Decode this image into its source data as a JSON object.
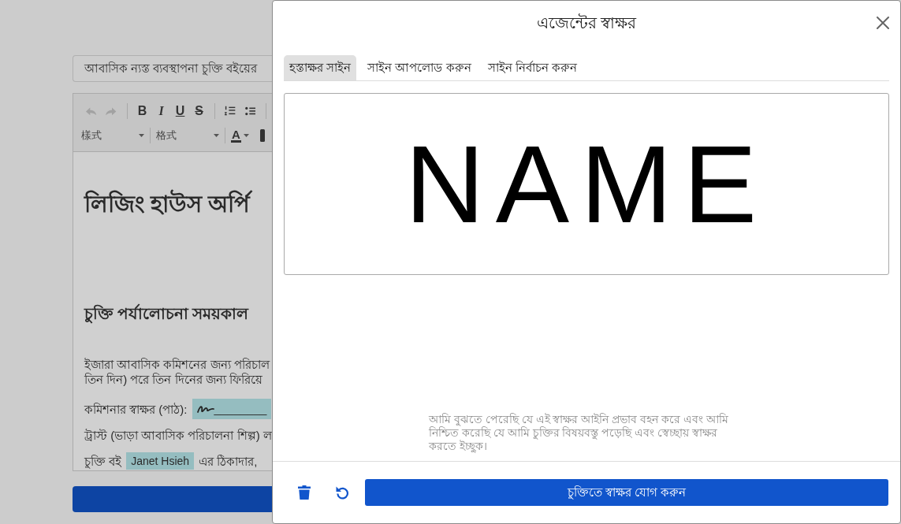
{
  "editor_page": {
    "title_field": {
      "value": "আবাসিক ন্যস্ত ব্যবস্থাপনা চুক্তি বইয়ের"
    },
    "toolbar": {
      "history": [
        {
          "kind": "undo",
          "disabled": true
        },
        {
          "kind": "redo",
          "disabled": true
        }
      ],
      "marks": [
        {
          "kind": "bold",
          "label": "B"
        },
        {
          "kind": "italic",
          "label": "I"
        },
        {
          "kind": "underline",
          "label": "U"
        },
        {
          "kind": "strike",
          "label": "S"
        }
      ],
      "selects": [
        {
          "value": "樣式"
        },
        {
          "value": "格式"
        }
      ],
      "text_color": {
        "label": "A"
      }
    },
    "document": {
      "heading": "লিজিং হাউস অর্পি",
      "subheading": "চুক্তি পর্যালোচনা সময়কাল",
      "intro_lines": [
        "ইজারা আবাসিক কমিশনের জন্য পরিচাল",
        "তিন দিন) পরে তিন দিনের জন্য ফিরিয়ে"
      ],
      "signature_line": {
        "label": "কমিশনার স্বাক্ষর (পাঠ):",
        "blank": "________"
      },
      "trust_line": "ট্রাস্ট (ভাড়া আবাসিক পরিচালনা শিল্প) ল",
      "book_line": {
        "before": "চুক্তি বই",
        "name": "Janet Hsieh",
        "after": "এর ঠিকাদার,"
      }
    }
  },
  "dialog": {
    "title": "এজেন্টের স্বাক্ষর",
    "tabs": [
      {
        "label": "হস্তাক্ষর সাইন",
        "selected": true
      },
      {
        "label": "সাইন আপলোড করুন",
        "selected": false
      },
      {
        "label": "সাইন নির্বাচন করুন",
        "selected": false
      }
    ],
    "signature": "NAME",
    "consent": "আমি বুঝতে পেরেছি যে এই স্বাক্ষর আইনি প্রভাব বহন করে এবং আমি নিশ্চিত করেছি যে আমি চুক্তির বিষয়বস্তু পড়েছি এবং স্বেচ্ছায় স্বাক্ষর করতে ইচ্ছুক।",
    "submit": "চুক্তিতে স্বাক্ষর যোগ করুন"
  }
}
